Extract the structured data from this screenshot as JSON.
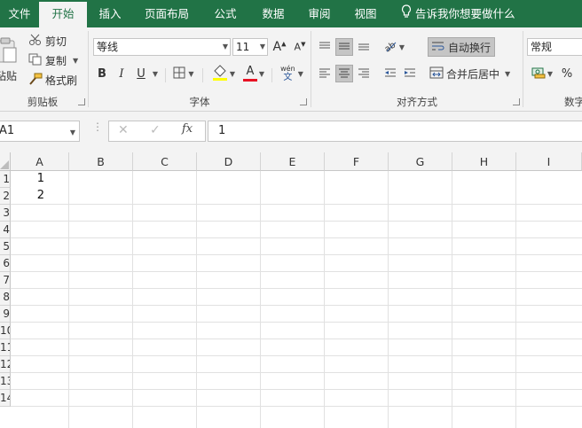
{
  "tabs": [
    "文件",
    "开始",
    "插入",
    "页面布局",
    "公式",
    "数据",
    "审阅",
    "视图"
  ],
  "active_tab": "开始",
  "tell_me": "告诉我你想要做什么",
  "clipboard": {
    "paste": "粘贴",
    "cut": "剪切",
    "copy": "复制",
    "format_painter": "格式刷",
    "group_label": "剪贴板"
  },
  "font": {
    "name": "等线",
    "size": "11",
    "grow_glyph": "A",
    "shrink_glyph": "A",
    "bold": "B",
    "italic": "I",
    "underline": "U",
    "font_color_glyph": "A",
    "phonetic_top": "wén",
    "phonetic_bottom": "文",
    "group_label": "字体",
    "highlight_color": "#ffff00",
    "font_color": "#e81123"
  },
  "alignment": {
    "wrap_text": "自动换行",
    "merge_center": "合并后居中",
    "group_label": "对齐方式"
  },
  "number": {
    "format": "常规",
    "percent": "%",
    "group_label": "数字"
  },
  "formula_bar": {
    "name_box": "A1",
    "fx": "fx",
    "value": "1"
  },
  "columns": [
    "A",
    "B",
    "C",
    "D",
    "E",
    "F",
    "G",
    "H",
    "I"
  ],
  "rows": [
    "1",
    "2",
    "3",
    "4",
    "5",
    "6",
    "7",
    "8",
    "9",
    "10",
    "11",
    "12",
    "13",
    "14"
  ],
  "cells": {
    "A1": "1",
    "A2": "2"
  },
  "colors": {
    "accent": "#217346",
    "ribbon_bg": "#f3f3f3"
  }
}
